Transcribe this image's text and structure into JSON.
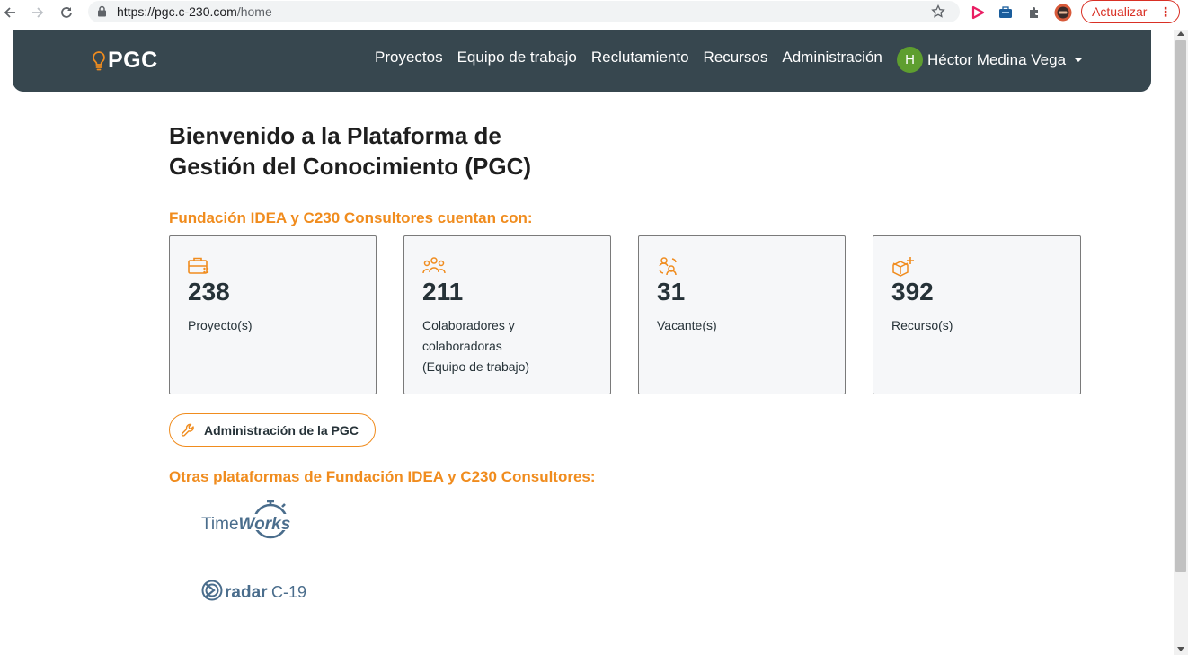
{
  "browser": {
    "url_host": "https://pgc.c-230.com",
    "url_path": "/home",
    "update_label": "Actualizar",
    "menu_glyph": "⋮"
  },
  "navbar": {
    "brand": "PGC",
    "links": [
      "Proyectos",
      "Equipo de trabajo",
      "Reclutamiento",
      "Recursos",
      "Administración"
    ],
    "user_initial": "H",
    "user_name": "Héctor Medina Vega"
  },
  "main": {
    "title_line1": "Bienvenido a la Plataforma de",
    "title_line2": "Gestión del Conocimiento (PGC)",
    "stats_heading": "Fundación IDEA y C230 Consultores cuentan con:",
    "cards": [
      {
        "icon": "briefcase-icon",
        "value": "238",
        "label_lines": [
          "Proyecto(s)"
        ]
      },
      {
        "icon": "team-icon",
        "value": "211",
        "label_lines": [
          "Colaboradores y",
          "colaboradoras",
          "(Equipo de trabajo)"
        ]
      },
      {
        "icon": "recruit-icon",
        "value": "31",
        "label_lines": [
          "Vacante(s)"
        ]
      },
      {
        "icon": "box-plus-icon",
        "value": "392",
        "label_lines": [
          "Recurso(s)"
        ]
      }
    ],
    "admin_button": "Administración de la PGC",
    "other_heading": "Otras plataformas de Fundación IDEA y C230 Consultores:",
    "platforms": [
      {
        "name_a": "Time",
        "name_b": "Works"
      },
      {
        "name_a": "radar",
        "name_b": "C-19"
      }
    ]
  },
  "colors": {
    "navbar_bg": "#37474f",
    "accent_orange": "#f08c1e",
    "avatar_green": "#5e9e2f",
    "logo_blue": "#4a6d8c"
  }
}
